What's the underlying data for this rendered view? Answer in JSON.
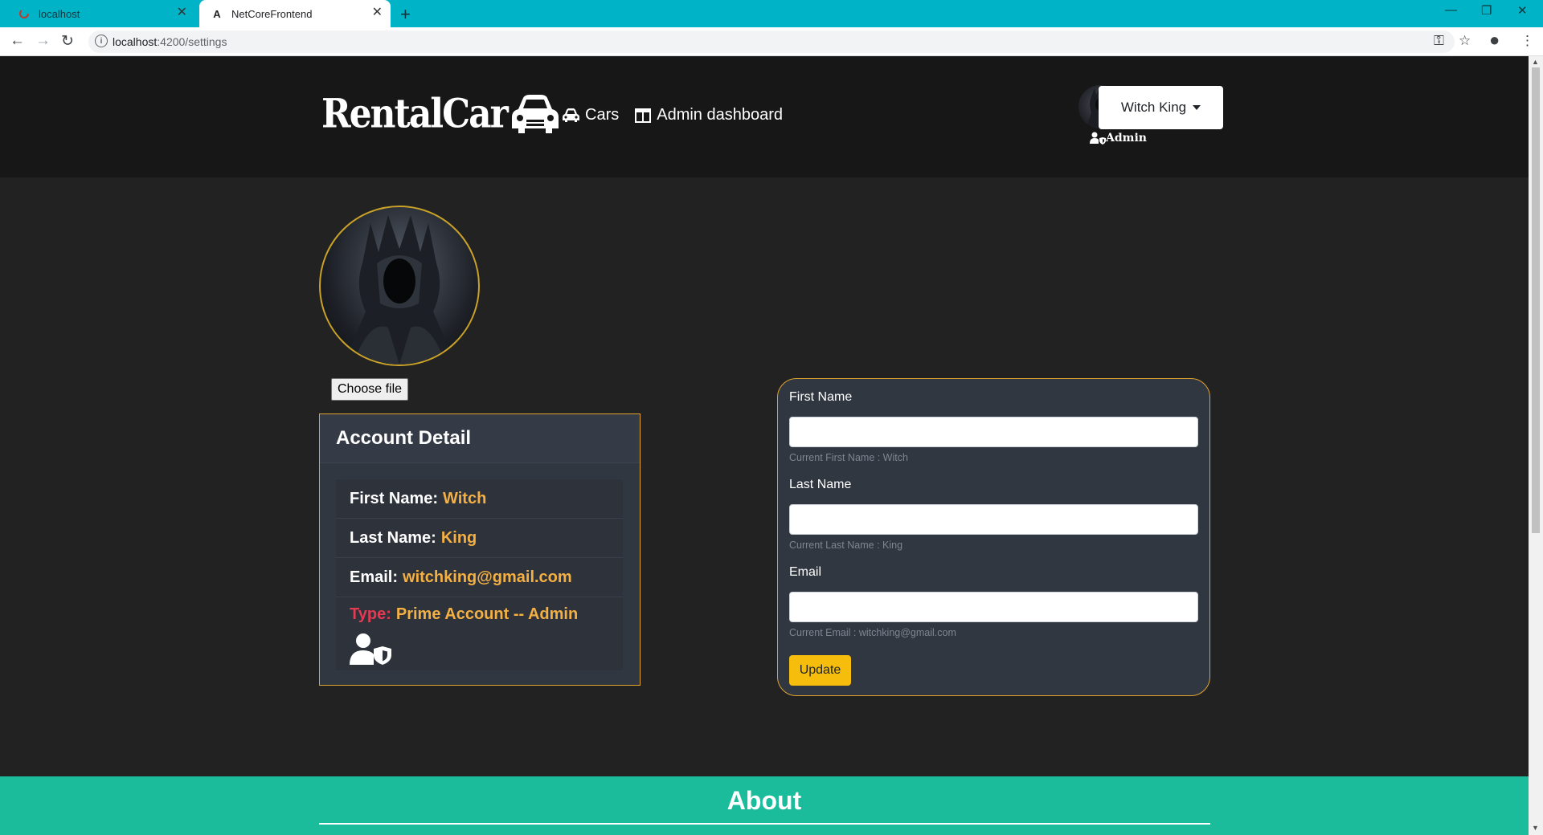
{
  "browser": {
    "tabs": [
      {
        "title": "localhost",
        "favicon": "loading-icon",
        "active": false
      },
      {
        "title": "NetCoreFrontend",
        "favicon": "angular-icon",
        "active": true
      }
    ],
    "url_host": "localhost",
    "url_path": ":4200/settings",
    "colors": {
      "tabbar": "#00b3c6"
    }
  },
  "header": {
    "logo_text": "RentalCar",
    "nav": [
      {
        "label": "Cars",
        "icon": "car-icon"
      },
      {
        "label": "Admin dashboard",
        "icon": "dashboard-icon"
      }
    ],
    "user_name": "Witch King",
    "role_tag": "Admin"
  },
  "profile": {
    "choose_file_label": "Choose file"
  },
  "account": {
    "title": "Account Detail",
    "first_name_label": "First Name:",
    "first_name": "Witch",
    "last_name_label": "Last Name:",
    "last_name": "King",
    "email_label": "Email:",
    "email": "witchking@gmail.com",
    "type_label": "Type:",
    "type_value": "Prime Account -- Admin"
  },
  "form": {
    "first_name_label": "First Name",
    "first_name_help": "Current First Name : Witch",
    "last_name_label": "Last Name",
    "last_name_help": "Current Last Name : King",
    "email_label": "Email",
    "email_help": "Current Email : witchking@gmail.com",
    "update_label": "Update",
    "colors": {
      "accent": "#e0a42e",
      "button": "#f7bd0d"
    }
  },
  "about": {
    "title": "About",
    "color": "#1abc9c"
  }
}
